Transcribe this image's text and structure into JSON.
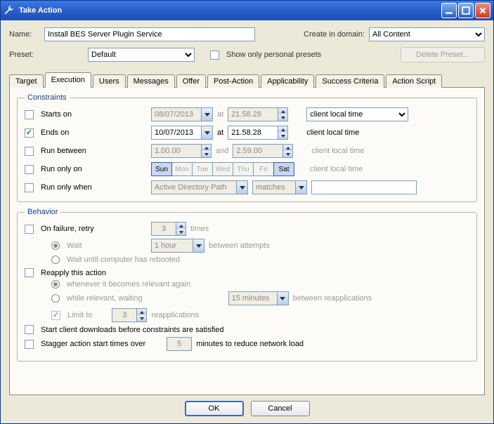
{
  "window": {
    "title": "Take Action"
  },
  "header": {
    "name_label": "Name:",
    "name_value": "Install BES Server Plugin Service",
    "domain_label": "Create in domain:",
    "domain_value": "All Content",
    "preset_label": "Preset:",
    "preset_value": "Default",
    "show_personal_label": "Show only personal presets",
    "delete_preset_label": "Delete Preset..."
  },
  "tabs": [
    "Target",
    "Execution",
    "Users",
    "Messages",
    "Offer",
    "Post-Action",
    "Applicability",
    "Success Criteria",
    "Action Script"
  ],
  "active_tab": "Execution",
  "constraints": {
    "legend": "Constraints",
    "starts_on_label": "Starts on",
    "starts_on_date": "08/07/2013",
    "starts_on_time": "21.58.28",
    "at_label": "at",
    "time_zone_combo": "client local time",
    "client_local_text": "client local time",
    "ends_on_label": "Ends on",
    "ends_on_date": "10/07/2013",
    "ends_on_time": "21.58.28",
    "run_between_label": "Run between",
    "run_between_from": "1.00.00",
    "run_between_to": "2.59.00",
    "and_label": "and",
    "run_only_on_label": "Run only on",
    "days": [
      "Sun",
      "Mon",
      "Tue",
      "Wed",
      "Thu",
      "Fri",
      "Sat"
    ],
    "run_only_when_label": "Run only when",
    "property_select": "Active Directory Path",
    "relation_select": "matches",
    "relation_value": ""
  },
  "behavior": {
    "legend": "Behavior",
    "on_failure_label": "On failure, retry",
    "retry_times": "3",
    "times_label": "times",
    "wait_label": "Wait",
    "wait_amount": "1 hour",
    "between_attempts_label": "between attempts",
    "wait_reboot_label": "Wait until computer has rebooted",
    "reapply_label": "Reapply this action",
    "whenever_label": "whenever it becomes relevant again",
    "while_relevant_label": "while relevant, waiting",
    "reapply_interval": "15 minutes",
    "between_reapps_label": "between reapplications",
    "limit_to_label": "Limit to",
    "limit_to_value": "3",
    "reapplications_label": "reapplications",
    "start_downloads_label": "Start client downloads before constraints are satisfied",
    "stagger_label": "Stagger action start times over",
    "stagger_value": "5",
    "stagger_suffix": "minutes to reduce network load"
  },
  "footer": {
    "ok": "OK",
    "cancel": "Cancel"
  }
}
